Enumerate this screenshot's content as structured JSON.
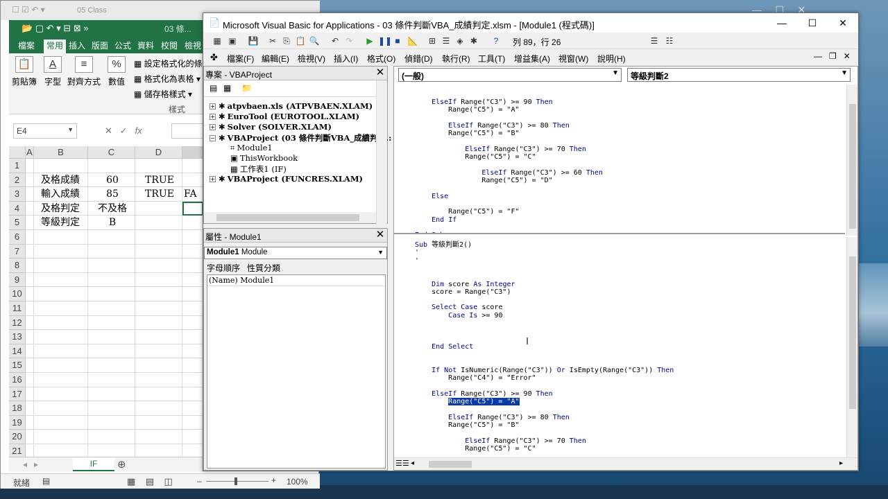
{
  "excel": {
    "title": "05 Class",
    "qat_title": "03 條...",
    "tabs": [
      "檔案",
      "常用",
      "插入",
      "版面",
      "公式",
      "資料",
      "校閱",
      "檢視"
    ],
    "ribbon": {
      "paste": "剪貼簿",
      "font": "字型",
      "align": "對齊方式",
      "number": "數值",
      "cond_format": "設定格式化的條",
      "format_table": "格式化為表格",
      "cell_style": "儲存格樣式",
      "styles_group": "樣式"
    },
    "name_box": "E4",
    "fx": "fx",
    "columns": [
      "A",
      "B",
      "C",
      "D"
    ],
    "rows": [
      "1",
      "2",
      "3",
      "4",
      "5",
      "6",
      "7",
      "8",
      "9",
      "10",
      "11",
      "12",
      "13",
      "14",
      "15",
      "16",
      "17",
      "18",
      "19",
      "20",
      "21"
    ],
    "cells": {
      "b2": "及格成績",
      "c2": "60",
      "d2": "TRUE",
      "b3": "輸入成績",
      "c3": "85",
      "d3": "TRUE",
      "e3": "FA",
      "b4": "及格判定",
      "c4": "不及格",
      "b5": "等級判定",
      "c5": "B"
    },
    "sheet_tab": "IF",
    "status": "就緒",
    "zoom": "100%"
  },
  "vba": {
    "title": "Microsoft Visual Basic for Applications - 03 條件判斷VBA_成績判定.xlsm - [Module1 (程式碼)]",
    "position": "列 89，行 26",
    "menu": [
      "檔案(F)",
      "編輯(E)",
      "檢視(V)",
      "插入(I)",
      "格式(O)",
      "偵錯(D)",
      "執行(R)",
      "工具(T)",
      "增益集(A)",
      "視窗(W)",
      "說明(H)"
    ],
    "project_title": "專案 - VBAProject",
    "project_items": [
      "atpvbaen.xls (ATPVBAEN.XLAM)",
      "EuroTool (EUROTOOL.XLAM)",
      "Solver (SOLVER.XLAM)",
      "VBAProject (03 條件判斷VBA_成績判定.:",
      "Module1",
      "ThisWorkbook",
      "工作表1 (IF)",
      "VBAProject (FUNCRES.XLAM)"
    ],
    "props_title": "屬性 - Module1",
    "props_combo_name": "Module1",
    "props_combo_type": "Module",
    "props_tabs": [
      "字母順序",
      "性質分類"
    ],
    "props_row_key": "(Name)",
    "props_row_val": "Module1",
    "combo_object": "(一般)",
    "combo_proc": "等級判斷2",
    "code_top": [
      "    ElseIf Range(\"C3\") >= 90 Then",
      "        Range(\"C5\") = \"A\"",
      "",
      "        ElseIf Range(\"C3\") >= 80 Then",
      "        Range(\"C5\") = \"B\"",
      "",
      "            ElseIf Range(\"C3\") >= 70 Then",
      "            Range(\"C5\") = \"C\"",
      "",
      "                ElseIf Range(\"C3\") >= 60 Then",
      "                Range(\"C5\") = \"D\"",
      "",
      "    Else",
      "",
      "        Range(\"C5\") = \"F\"",
      "    End If",
      "",
      "End Sub"
    ],
    "code_bottom": [
      "Sub 等級判斷2()",
      "'",
      "'",
      "",
      "",
      "    Dim score As Integer",
      "    score = Range(\"C3\")",
      "",
      "    Select Case score",
      "        Case Is >= 90",
      "",
      "",
      "",
      "    End Select",
      "",
      "",
      "    If Not IsNumeric(Range(\"C3\")) Or IsEmpty(Range(\"C3\")) Then",
      "        Range(\"C4\") = \"Error\"",
      "",
      "    ElseIf Range(\"C3\") >= 90 Then",
      "        Range(\"C5\") = \"A\"",
      "",
      "        ElseIf Range(\"C3\") >= 80 Then",
      "        Range(\"C5\") = \"B\"",
      "",
      "            ElseIf Range(\"C3\") >= 70 Then",
      "            Range(\"C5\") = \"C\""
    ],
    "highlight_line": 20
  }
}
